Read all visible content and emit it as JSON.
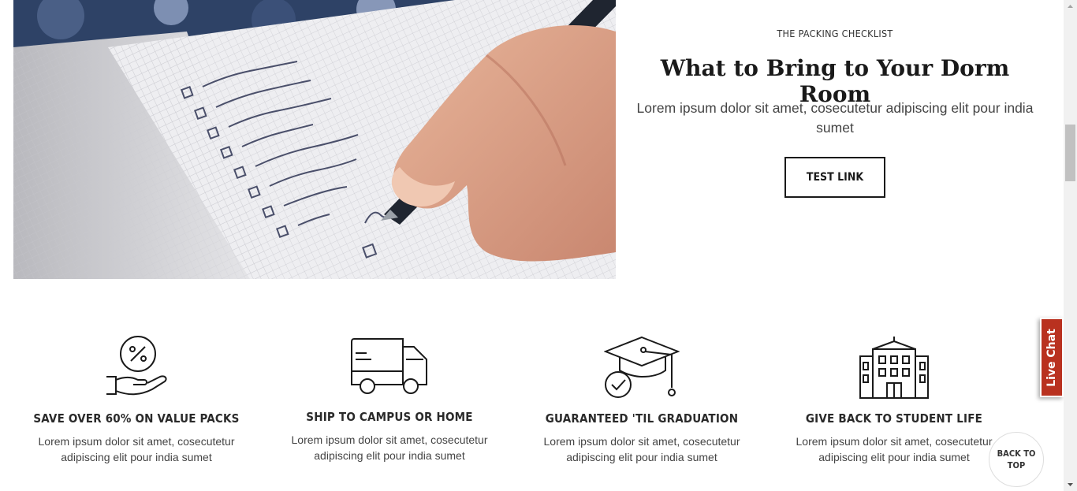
{
  "promo": {
    "eyebrow": "THE PACKING CHECKLIST",
    "headline": "What to Bring to Your Dorm Room",
    "body": "Lorem ipsum dolor sit amet, cosecutetur adipiscing elit pour india sumet",
    "cta_label": "TEST LINK",
    "image_alt_icon": "notebook-checklist-photo"
  },
  "features": [
    {
      "icon": "percent-hand-icon",
      "title": "SAVE OVER 60% ON VALUE PACKS",
      "body": "Lorem ipsum dolor sit amet, cosecutetur adipiscing elit pour india sumet"
    },
    {
      "icon": "delivery-truck-icon",
      "title": "SHIP TO CAMPUS OR HOME",
      "body": "Lorem ipsum dolor sit amet, cosecutetur adipiscing elit pour india sumet"
    },
    {
      "icon": "graduation-cap-icon",
      "title": "GUARANTEED 'TIL GRADUATION",
      "body": "Lorem ipsum dolor sit amet, cosecutetur adipiscing elit pour india sumet"
    },
    {
      "icon": "school-building-icon",
      "title": "GIVE BACK TO STUDENT LIFE",
      "body": "Lorem ipsum dolor sit amet, cosecutetur adipiscing elit pour india sumet"
    }
  ],
  "live_chat": {
    "label": "Live Chat",
    "color": "#b9311f"
  },
  "back_to_top": {
    "line1": "BACK TO",
    "line2": "TOP"
  }
}
